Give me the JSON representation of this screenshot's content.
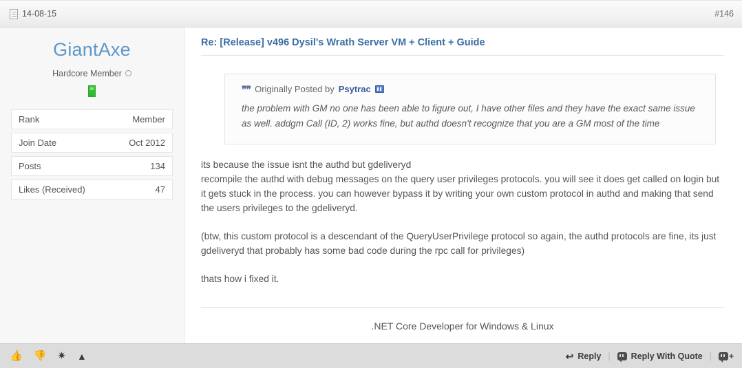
{
  "header": {
    "date": "14-08-15",
    "date_icon": "document-icon",
    "post_number": "#146"
  },
  "user": {
    "username": "GiantAxe",
    "title": "Hardcore Member",
    "status_icon": "offline-circle-icon",
    "rank_badge_icon": "green-rank-badge-icon",
    "stats": [
      {
        "label": "Rank",
        "value": "Member"
      },
      {
        "label": "Join Date",
        "value": "Oct 2012"
      },
      {
        "label": "Posts",
        "value": "134"
      },
      {
        "label": "Likes (Received)",
        "value": "47"
      }
    ]
  },
  "post": {
    "thread_title": "Re: [Release] v496 Dysil's Wrath Server VM + Client + Guide",
    "quote": {
      "marks_icon": "quote-marks-icon",
      "prefix": "Originally Posted by",
      "author": "Psytrac",
      "viewpost_icon": "view-post-icon",
      "text": "the problem with GM no one has been able to figure out, I have other files and they have the exact same issue as well. addgm Call (ID, 2) works fine, but authd doesn't recognize that you are a GM most of the time"
    },
    "paragraphs": [
      "its because the issue isnt the authd but gdeliveryd\nrecompile the authd with debug messages on the query user privileges protocols. you will see it does get called on login but it gets stuck in the process. you can however bypass it by writing your own custom protocol in authd and making that send the users privileges to the gdeliveryd.",
      "(btw, this custom protocol is a descendant of the QueryUserPrivilege protocol so again, the authd protocols are fine, its just gdeliveryd that probably has some bad code during the rpc call for privileges)",
      "thats how i fixed it."
    ],
    "signature": ".NET Core Developer for Windows & Linux"
  },
  "footer": {
    "like_icon": "thumbs-up-icon",
    "dislike_icon": "thumbs-down-icon",
    "star_icon": "star-icon",
    "report_icon": "warning-triangle-icon",
    "reply_icon": "reply-arrow-icon",
    "reply_label": "Reply",
    "separator": "|",
    "quote_icon": "speech-bubble-icon",
    "reply_quote_label": "Reply With Quote",
    "multiquote_icon": "multi-quote-add-icon",
    "multiquote_plus": "+"
  },
  "colors": {
    "username": "#5f97c9",
    "thread_title": "#3a6ea5",
    "rank_badge": "#2fb62f",
    "footer_bg": "#dcdcdc",
    "panel_bg": "#f7f7f7"
  }
}
